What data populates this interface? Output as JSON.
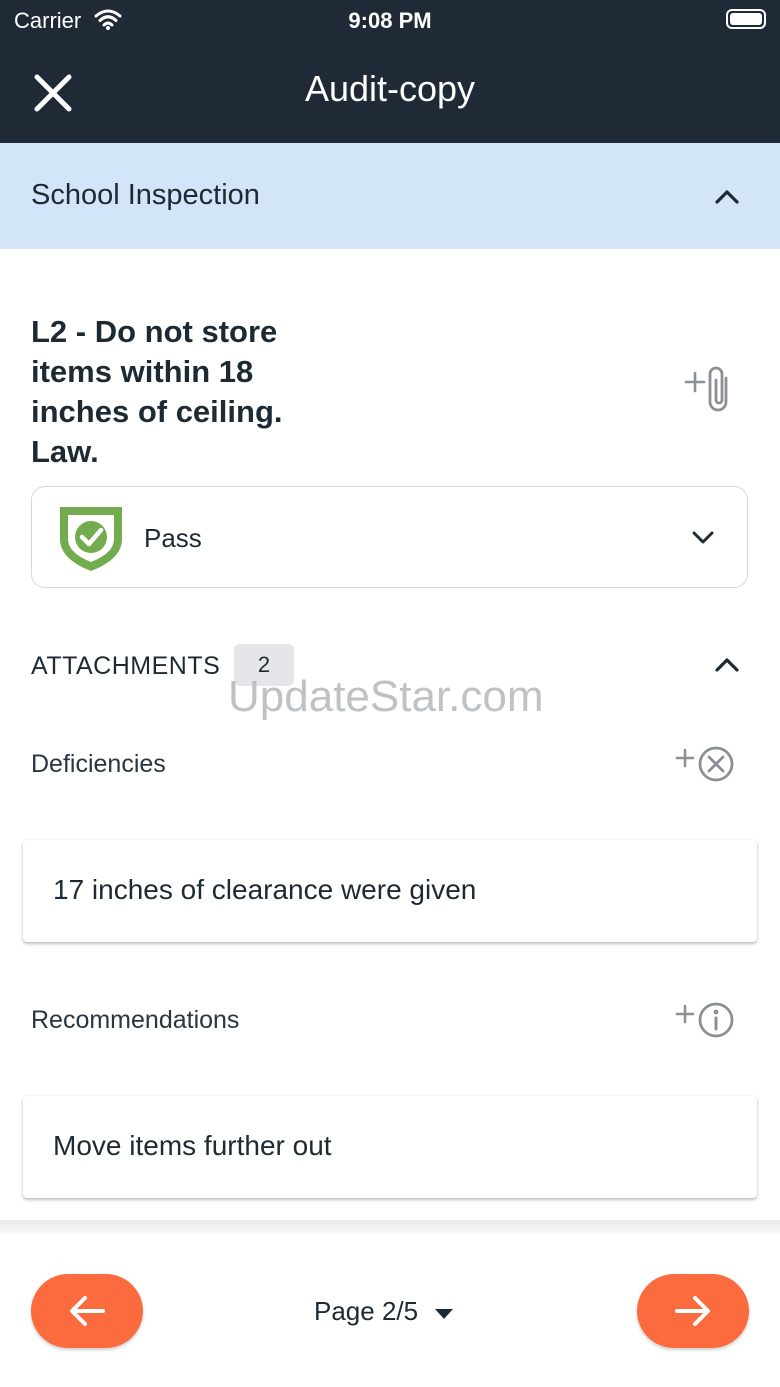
{
  "status_bar": {
    "carrier": "Carrier",
    "time": "9:08 PM"
  },
  "nav": {
    "title": "Audit-copy"
  },
  "section": {
    "title": "School Inspection"
  },
  "question": {
    "title": "L2 - Do not store items within 18 inches of ceiling. Law.",
    "result": "Pass"
  },
  "attachments": {
    "label": "ATTACHMENTS",
    "count": "2",
    "deficiencies": {
      "label": "Deficiencies",
      "text": "17 inches of clearance were given"
    },
    "recommendations": {
      "label": "Recommendations",
      "text": "Move items further out"
    }
  },
  "watermark": "UpdateStar.com",
  "footer": {
    "page_indicator": "Page 2/5"
  },
  "colors": {
    "navbar": "#1f2a36",
    "section_bg": "#d3e5f8",
    "accent": "#fb6b3e",
    "pass_green": "#72ac4e"
  }
}
